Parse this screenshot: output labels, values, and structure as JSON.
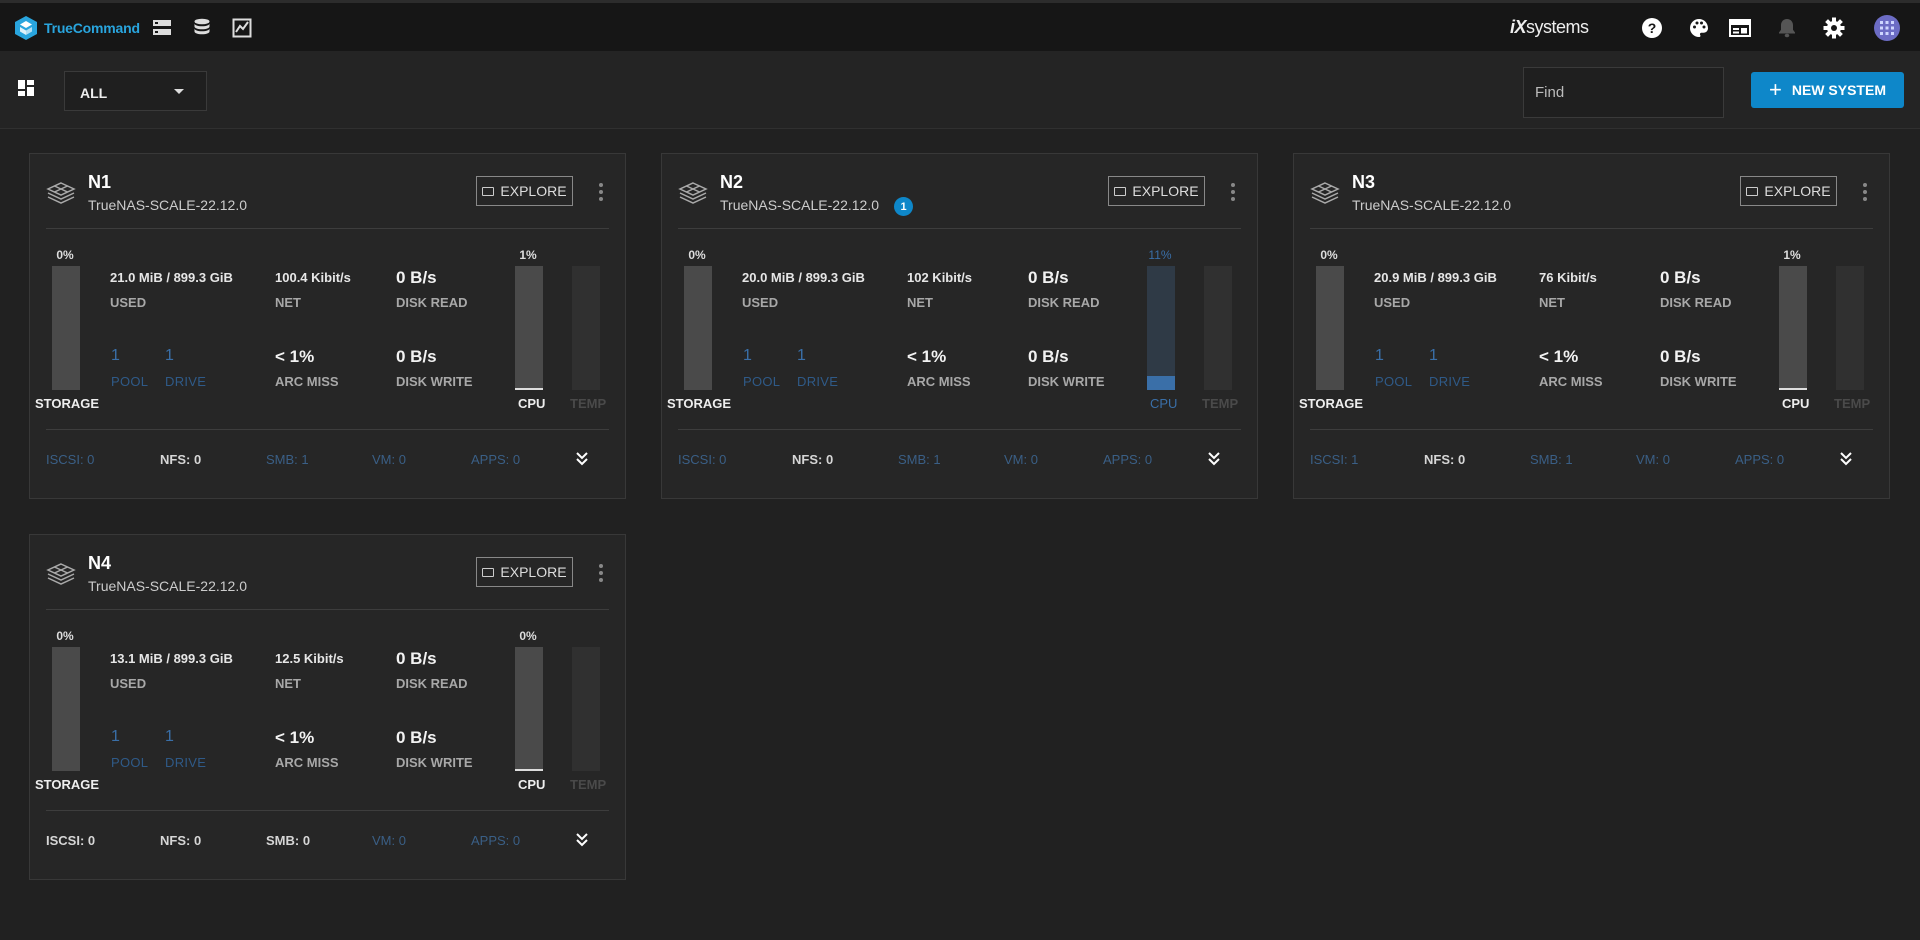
{
  "app": {
    "brand": "TrueCommand",
    "vendor_bold": "iX",
    "vendor_rest": "systems",
    "accent": "#0e87c9",
    "link_color": "#3a6fa8"
  },
  "toolbar": {
    "filter_value": "ALL",
    "find_placeholder": "Find",
    "new_system_label": "NEW SYSTEM"
  },
  "header_icons": [
    "systems-icon",
    "database-icon",
    "reports-icon",
    "help-icon",
    "palette-icon",
    "dashboard-icon",
    "notifications-icon",
    "settings-icon",
    "user-avatar-icon"
  ],
  "systems": [
    {
      "name": "N1",
      "version": "TrueNAS-SCALE-22.12.0",
      "badge": null,
      "explore_label": "EXPLORE",
      "storage_pct": "0%",
      "storage_label": "STORAGE",
      "used": "21.0 MiB / 899.3 GiB",
      "used_label": "USED",
      "net": "100.4 Kibit/s",
      "net_label": "NET",
      "disk_read": "0 B/s",
      "disk_read_label": "DISK READ",
      "pool_count": "1",
      "pool_label": "POOL",
      "drive_count": "1",
      "drive_label": "DRIVE",
      "arc_miss": "< 1%",
      "arc_miss_label": "ARC MISS",
      "disk_write": "0 B/s",
      "disk_write_label": "DISK WRITE",
      "cpu_pct": "1%",
      "cpu_value": 0.01,
      "cpu_label": "CPU",
      "temp_label": "TEMP",
      "iscsi": "ISCSI: 0",
      "nfs": "NFS: 0",
      "smb": "SMB: 1",
      "vm": "VM: 0",
      "apps": "APPS: 0"
    },
    {
      "name": "N2",
      "version": "TrueNAS-SCALE-22.12.0",
      "badge": "1",
      "explore_label": "EXPLORE",
      "storage_pct": "0%",
      "storage_label": "STORAGE",
      "used": "20.0 MiB / 899.3 GiB",
      "used_label": "USED",
      "net": "102 Kibit/s",
      "net_label": "NET",
      "disk_read": "0 B/s",
      "disk_read_label": "DISK READ",
      "pool_count": "1",
      "pool_label": "POOL",
      "drive_count": "1",
      "drive_label": "DRIVE",
      "arc_miss": "< 1%",
      "arc_miss_label": "ARC MISS",
      "disk_write": "0 B/s",
      "disk_write_label": "DISK WRITE",
      "cpu_pct": "11%",
      "cpu_value": 0.11,
      "cpu_label": "CPU",
      "temp_label": "TEMP",
      "iscsi": "ISCSI: 0",
      "nfs": "NFS: 0",
      "smb": "SMB: 1",
      "vm": "VM: 0",
      "apps": "APPS: 0"
    },
    {
      "name": "N3",
      "version": "TrueNAS-SCALE-22.12.0",
      "badge": null,
      "explore_label": "EXPLORE",
      "storage_pct": "0%",
      "storage_label": "STORAGE",
      "used": "20.9 MiB / 899.3 GiB",
      "used_label": "USED",
      "net": "76 Kibit/s",
      "net_label": "NET",
      "disk_read": "0 B/s",
      "disk_read_label": "DISK READ",
      "pool_count": "1",
      "pool_label": "POOL",
      "drive_count": "1",
      "drive_label": "DRIVE",
      "arc_miss": "< 1%",
      "arc_miss_label": "ARC MISS",
      "disk_write": "0 B/s",
      "disk_write_label": "DISK WRITE",
      "cpu_pct": "1%",
      "cpu_value": 0.01,
      "cpu_label": "CPU",
      "temp_label": "TEMP",
      "iscsi": "ISCSI: 1",
      "nfs": "NFS: 0",
      "smb": "SMB: 1",
      "vm": "VM: 0",
      "apps": "APPS: 0"
    },
    {
      "name": "N4",
      "version": "TrueNAS-SCALE-22.12.0",
      "badge": null,
      "explore_label": "EXPLORE",
      "storage_pct": "0%",
      "storage_label": "STORAGE",
      "used": "13.1 MiB / 899.3 GiB",
      "used_label": "USED",
      "net": "12.5 Kibit/s",
      "net_label": "NET",
      "disk_read": "0 B/s",
      "disk_read_label": "DISK READ",
      "pool_count": "1",
      "pool_label": "POOL",
      "drive_count": "1",
      "drive_label": "DRIVE",
      "arc_miss": "< 1%",
      "arc_miss_label": "ARC MISS",
      "disk_write": "0 B/s",
      "disk_write_label": "DISK WRITE",
      "cpu_pct": "0%",
      "cpu_value": 0.0,
      "cpu_label": "CPU",
      "temp_label": "TEMP",
      "iscsi": "ISCSI: 0",
      "nfs": "NFS: 0",
      "smb": "SMB: 0",
      "vm": "VM: 0",
      "apps": "APPS: 0"
    }
  ]
}
